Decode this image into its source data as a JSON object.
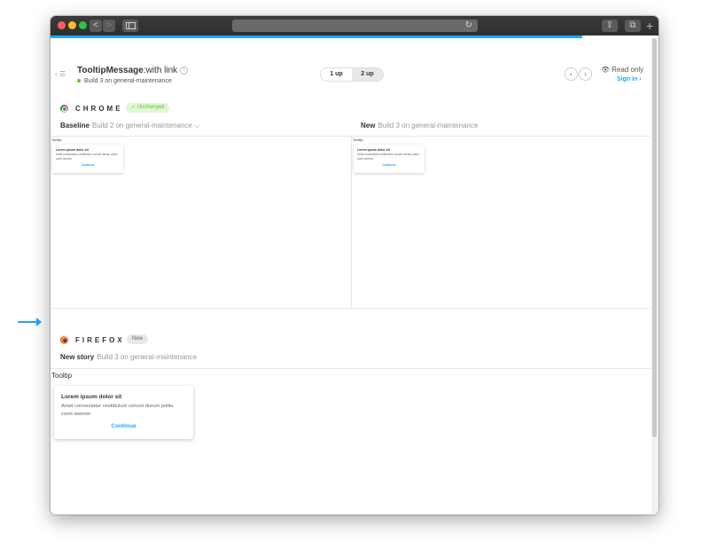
{
  "browser": {
    "nav_back": "<",
    "nav_forward": ">",
    "reload": "↻",
    "share": "⇪",
    "tabs": "⧉",
    "new_tab": "+"
  },
  "header": {
    "nav_toggle": "‹ ☰",
    "component": "TooltipMessage",
    "separator": ":",
    "story": "with link",
    "info": "i",
    "build": "Build 3 on general-maintenance",
    "view_1up": "1 up",
    "view_2up": "2 up",
    "prev": "‹",
    "next": "›",
    "read_only": "Read only",
    "eye": "👁",
    "sign_in": "Sign in ›"
  },
  "chrome_section": {
    "browser": "CHROME",
    "status": "✓ Unchanged",
    "baseline_label": "Baseline",
    "baseline_build": "Build 2 on general-maintenance ⌵",
    "new_label": "New",
    "new_build": "Build 3 on general-maintenance"
  },
  "firefox_section": {
    "browser": "FIREFOX",
    "status": "New",
    "newstory_label": "New story",
    "newstory_build": "Build 3 on general-maintenance"
  },
  "tooltip": {
    "label": "Tooltip",
    "title": "Lorem ipsum dolor sit",
    "body": "Amet consectatur vestibulum concet durum politu coret weirom",
    "cta": "Continue"
  },
  "colors": {
    "accent": "#1ea7fd",
    "success": "#66bf3c",
    "titlebar": "#2e2e2e"
  }
}
